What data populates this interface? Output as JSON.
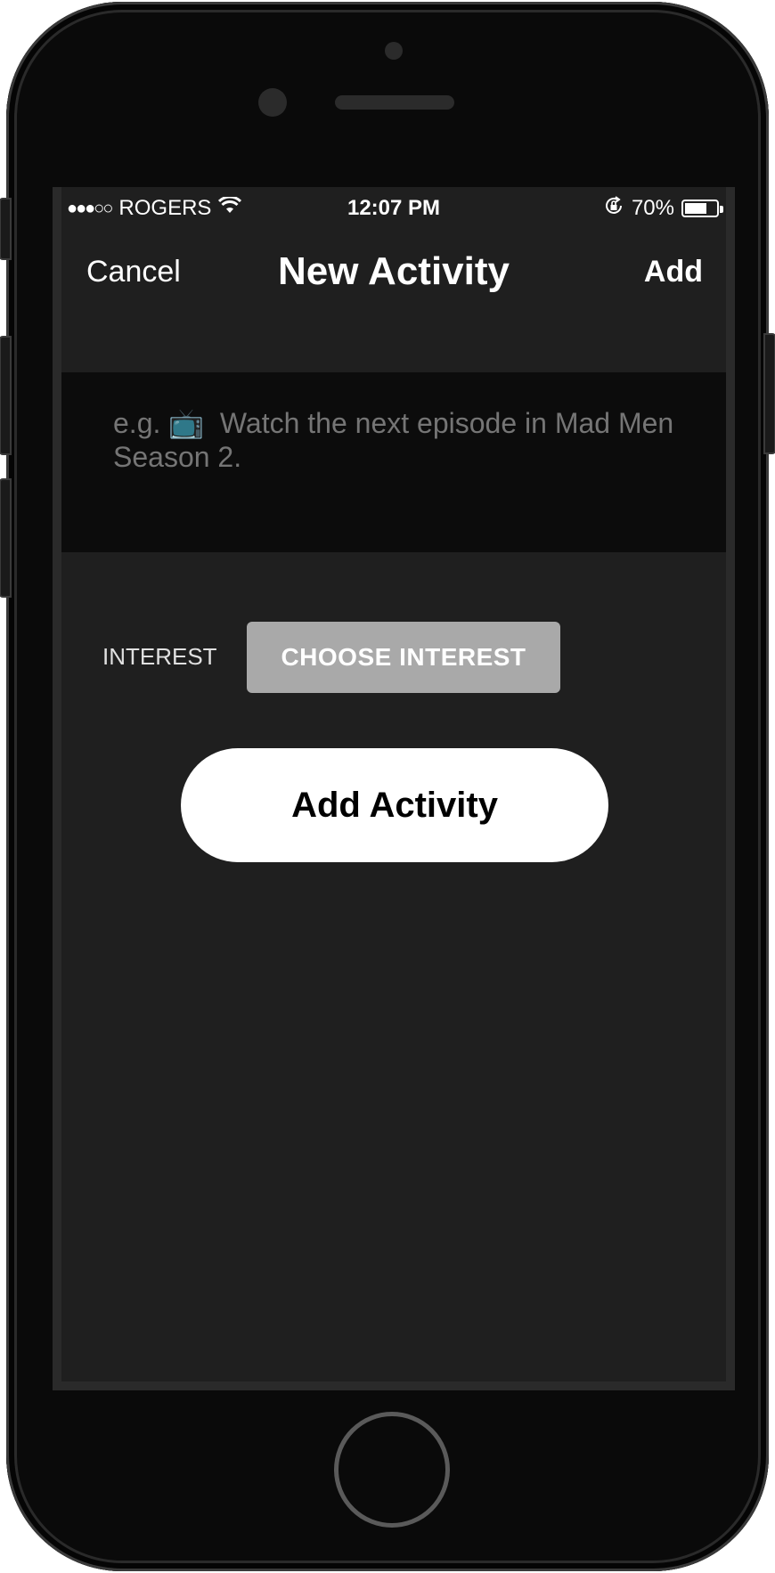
{
  "status_bar": {
    "signal": "●●●○○",
    "carrier": "ROGERS",
    "time": "12:07 PM",
    "battery_percent": "70%",
    "battery_level": 0.7
  },
  "nav": {
    "cancel_label": "Cancel",
    "title": "New Activity",
    "add_label": "Add"
  },
  "activity_input": {
    "placeholder": "e.g. 📺  Watch the next episode in Mad Men Season 2.",
    "value": ""
  },
  "interest": {
    "label": "INTEREST",
    "button_label": "CHOOSE INTEREST"
  },
  "add_activity_button": "Add Activity",
  "colors": {
    "screen_bg": "#1f1f1f",
    "input_bg": "#0c0c0c",
    "choose_button_bg": "#a9a9a9",
    "primary_button_bg": "#ffffff"
  }
}
